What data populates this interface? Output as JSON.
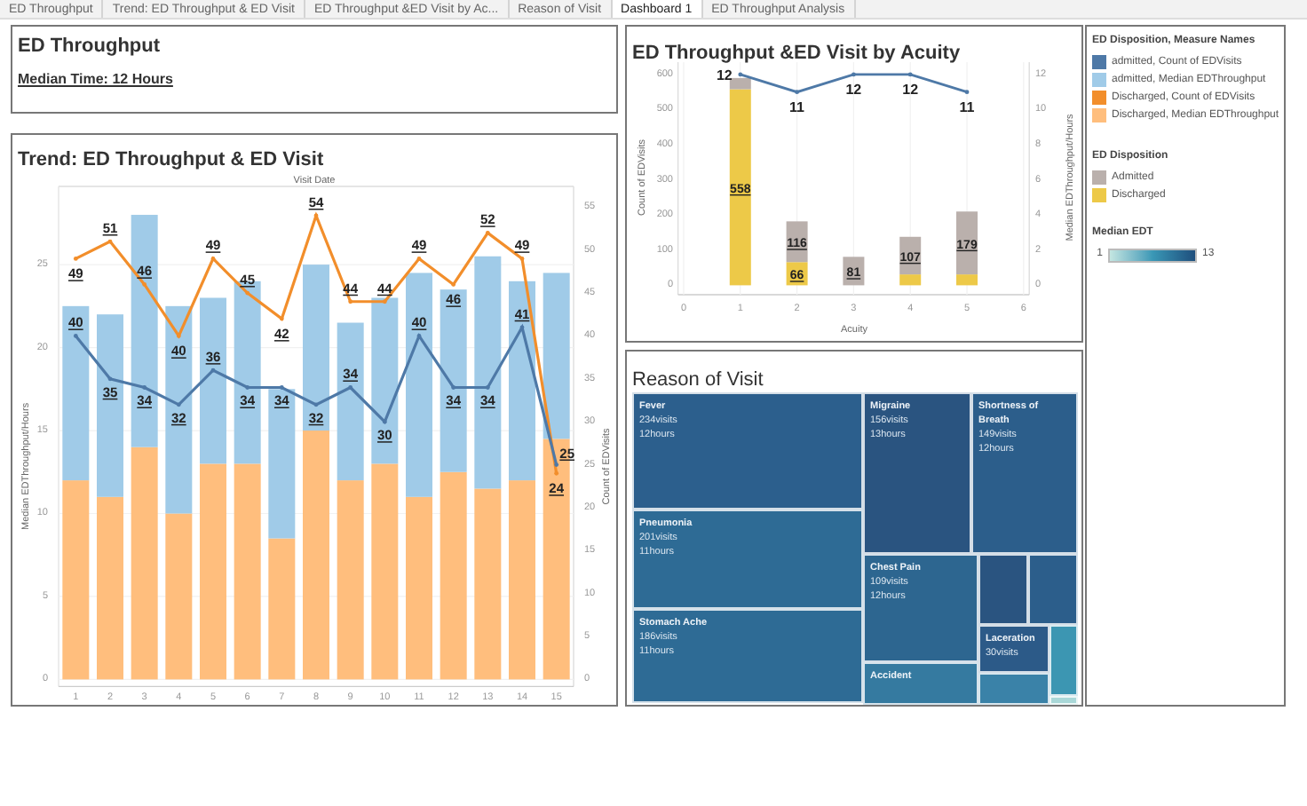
{
  "tabs": [
    {
      "label": "ED Throughput",
      "selected": false
    },
    {
      "label": "Trend: ED Throughput & ED Visit",
      "selected": false
    },
    {
      "label": "ED Throughput &ED Visit by Ac...",
      "selected": false
    },
    {
      "label": "Reason of Visit",
      "selected": false
    },
    {
      "label": "Dashboard 1",
      "selected": true
    },
    {
      "label": "ED Throughput Analysis",
      "selected": false
    }
  ],
  "summary": {
    "title": "ED Throughput",
    "median_time": "Median Time: 12 Hours"
  },
  "trend": {
    "title": "Trend: ED Throughput & ED Visit",
    "chart_data": {
      "type": "bar",
      "stacked": true,
      "xlabel": "Visit Date",
      "ylabel": "Median EDThroughput/Hours",
      "y2label": "Count of EDVisits",
      "grid": true,
      "x": [
        1,
        2,
        3,
        4,
        5,
        6,
        7,
        8,
        9,
        10,
        11,
        12,
        13,
        14,
        15
      ],
      "xlim": [
        0.5,
        15.5
      ],
      "xticks": [
        1,
        2,
        3,
        4,
        5,
        6,
        7,
        8,
        9,
        10,
        11,
        12,
        13,
        14,
        15
      ],
      "ylim": [
        0,
        29.5
      ],
      "y2lim": [
        0,
        57
      ],
      "yticks": [
        0,
        5,
        10,
        15,
        20,
        25
      ],
      "y2ticks": [
        0,
        5,
        10,
        15,
        20,
        25,
        30,
        35,
        40,
        45,
        50,
        55
      ],
      "series": [
        {
          "color": "#ffbe7d",
          "type": "bar",
          "values": [
            12,
            11,
            14,
            10,
            13,
            13,
            8.5,
            15,
            12,
            13,
            11,
            12.5,
            11.5,
            12,
            14.5
          ]
        },
        {
          "color": "#a0cbe8",
          "type": "bar",
          "values": [
            10.5,
            11,
            14,
            12.5,
            10,
            11,
            9,
            10,
            9.5,
            10,
            13.5,
            11,
            14,
            12,
            10
          ]
        },
        {
          "color": "#f28e2b",
          "type": "line",
          "axis": "y2",
          "values": [
            49,
            51,
            46,
            40,
            49,
            45,
            42,
            54,
            44,
            44,
            49,
            46,
            52,
            49,
            24
          ],
          "value_labels": [
            "49",
            "51",
            "46",
            "40",
            "49",
            "45",
            "42",
            "54",
            "44",
            "44",
            "49",
            "46",
            "52",
            "49",
            "24"
          ]
        },
        {
          "color": "#4e79a7",
          "type": "line",
          "axis": "y2",
          "values": [
            40,
            35,
            34,
            32,
            36,
            34,
            34,
            32,
            34,
            30,
            40,
            34,
            34,
            41,
            25
          ],
          "value_labels": [
            "40",
            "35",
            "34",
            "32",
            "36",
            "34",
            "34",
            "32",
            "34",
            "30",
            "40",
            "34",
            "34",
            "41",
            "25"
          ]
        }
      ]
    }
  },
  "acuity": {
    "title": "ED Throughput &ED Visit by Acuity",
    "chart_data": {
      "type": "bar",
      "stacked": true,
      "xlabel": "Acuity",
      "ylabel": "Count of EDVisits",
      "y2label": "Median EDThroughput/Hours",
      "grid": true,
      "x": [
        1,
        2,
        3,
        4,
        5
      ],
      "xlim": [
        -0.1,
        6.1
      ],
      "xticks": [
        0,
        1,
        2,
        3,
        4,
        5,
        6
      ],
      "ylim": [
        0,
        620
      ],
      "y2lim": [
        0,
        12.4
      ],
      "yticks": [
        0,
        100,
        200,
        300,
        400,
        500,
        600
      ],
      "y2ticks": [
        0,
        2,
        4,
        6,
        8,
        10,
        12
      ],
      "series": [
        {
          "color": "#edc948",
          "type": "bar",
          "values": [
            558,
            66,
            0,
            31,
            31
          ],
          "value_labels": [
            "558",
            "66",
            null,
            null,
            null
          ]
        },
        {
          "color": "#bab0ac",
          "type": "bar",
          "values": [
            32,
            116,
            81,
            107,
            179
          ],
          "value_labels": [
            null,
            "116",
            "81",
            "107",
            "179"
          ]
        },
        {
          "color": "#4e79a7",
          "type": "line",
          "axis": "y2",
          "values": [
            12,
            11,
            12,
            12,
            11
          ],
          "value_labels": [
            "12",
            "11",
            "12",
            "12",
            "11"
          ]
        }
      ]
    }
  },
  "reason": {
    "title": "Reason of Visit",
    "tiles": [
      {
        "label": "Fever",
        "lines": [
          "234visits",
          "12hours"
        ],
        "color": "#2c5f8d"
      },
      {
        "label": "Pneumonia",
        "lines": [
          "201visits",
          "11hours"
        ],
        "color": "#2e6b95"
      },
      {
        "label": "Stomach Ache",
        "lines": [
          "186visits",
          "11hours"
        ],
        "color": "#2e6b95"
      },
      {
        "label": "Migraine",
        "lines": [
          "156visits",
          "13hours"
        ],
        "color": "#2a5480"
      },
      {
        "label": "Shortness of Breath",
        "lines": [
          "149visits",
          "12hours"
        ],
        "color": "#2c5e8b"
      },
      {
        "label": "Chest Pain",
        "lines": [
          "109visits",
          "12hours"
        ],
        "color": "#2d6690"
      },
      {
        "label": "Accident",
        "color": "#357aa0"
      },
      {
        "color": "#2a5480"
      },
      {
        "color": "#2c5e8b"
      },
      {
        "label": "Laceration",
        "lines": [
          "30visits"
        ],
        "color": "#2c5a88"
      },
      {
        "color": "#3a82a8"
      },
      {
        "color": "#3c96b2"
      },
      {
        "color": "#a9d8d8"
      }
    ]
  },
  "legend": {
    "sections": [
      {
        "title": "ED Disposition, Measure Names",
        "items": [
          {
            "label": "admitted, Count of EDVisits",
            "color": "#4e79a7"
          },
          {
            "label": "admitted, Median EDThroughput",
            "color": "#a0cbe8"
          },
          {
            "label": "Discharged, Count of EDVisits",
            "color": "#f28e2b"
          },
          {
            "label": "Discharged, Median EDThroughput",
            "color": "#ffbe7d"
          }
        ]
      },
      {
        "title": "ED Disposition",
        "items": [
          {
            "label": "Admitted",
            "color": "#bab0ac"
          },
          {
            "label": "Discharged",
            "color": "#edc948"
          }
        ]
      }
    ],
    "gradient": {
      "title": "Median EDT",
      "min": "1",
      "max": "13"
    }
  }
}
